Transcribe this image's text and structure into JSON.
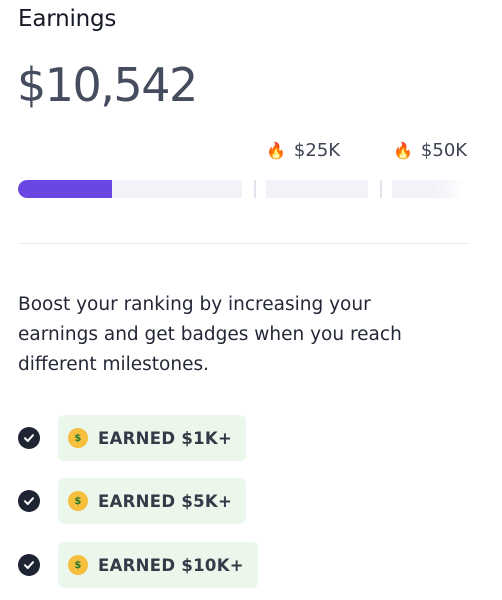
{
  "header": {
    "title": "Earnings",
    "amount": "$10,542"
  },
  "progress": {
    "current_value": 10542,
    "milestones": [
      {
        "label": "$25K",
        "icon": "fire-icon"
      },
      {
        "label": "$50K",
        "icon": "fire-icon"
      }
    ],
    "fill_color": "#6a47e3"
  },
  "description": "Boost your ranking by increasing your earnings and get badges when you reach different milestones.",
  "badges": [
    {
      "label": "EARNED $1K+",
      "icon": "money-mouth-face-icon",
      "checked": true
    },
    {
      "label": "EARNED $5K+",
      "icon": "money-mouth-face-icon",
      "checked": true
    },
    {
      "label": "EARNED $10K+",
      "icon": "money-mouth-face-icon",
      "checked": true
    }
  ],
  "colors": {
    "badge_background": "#eaf7ea",
    "check_background": "#1f2433"
  }
}
